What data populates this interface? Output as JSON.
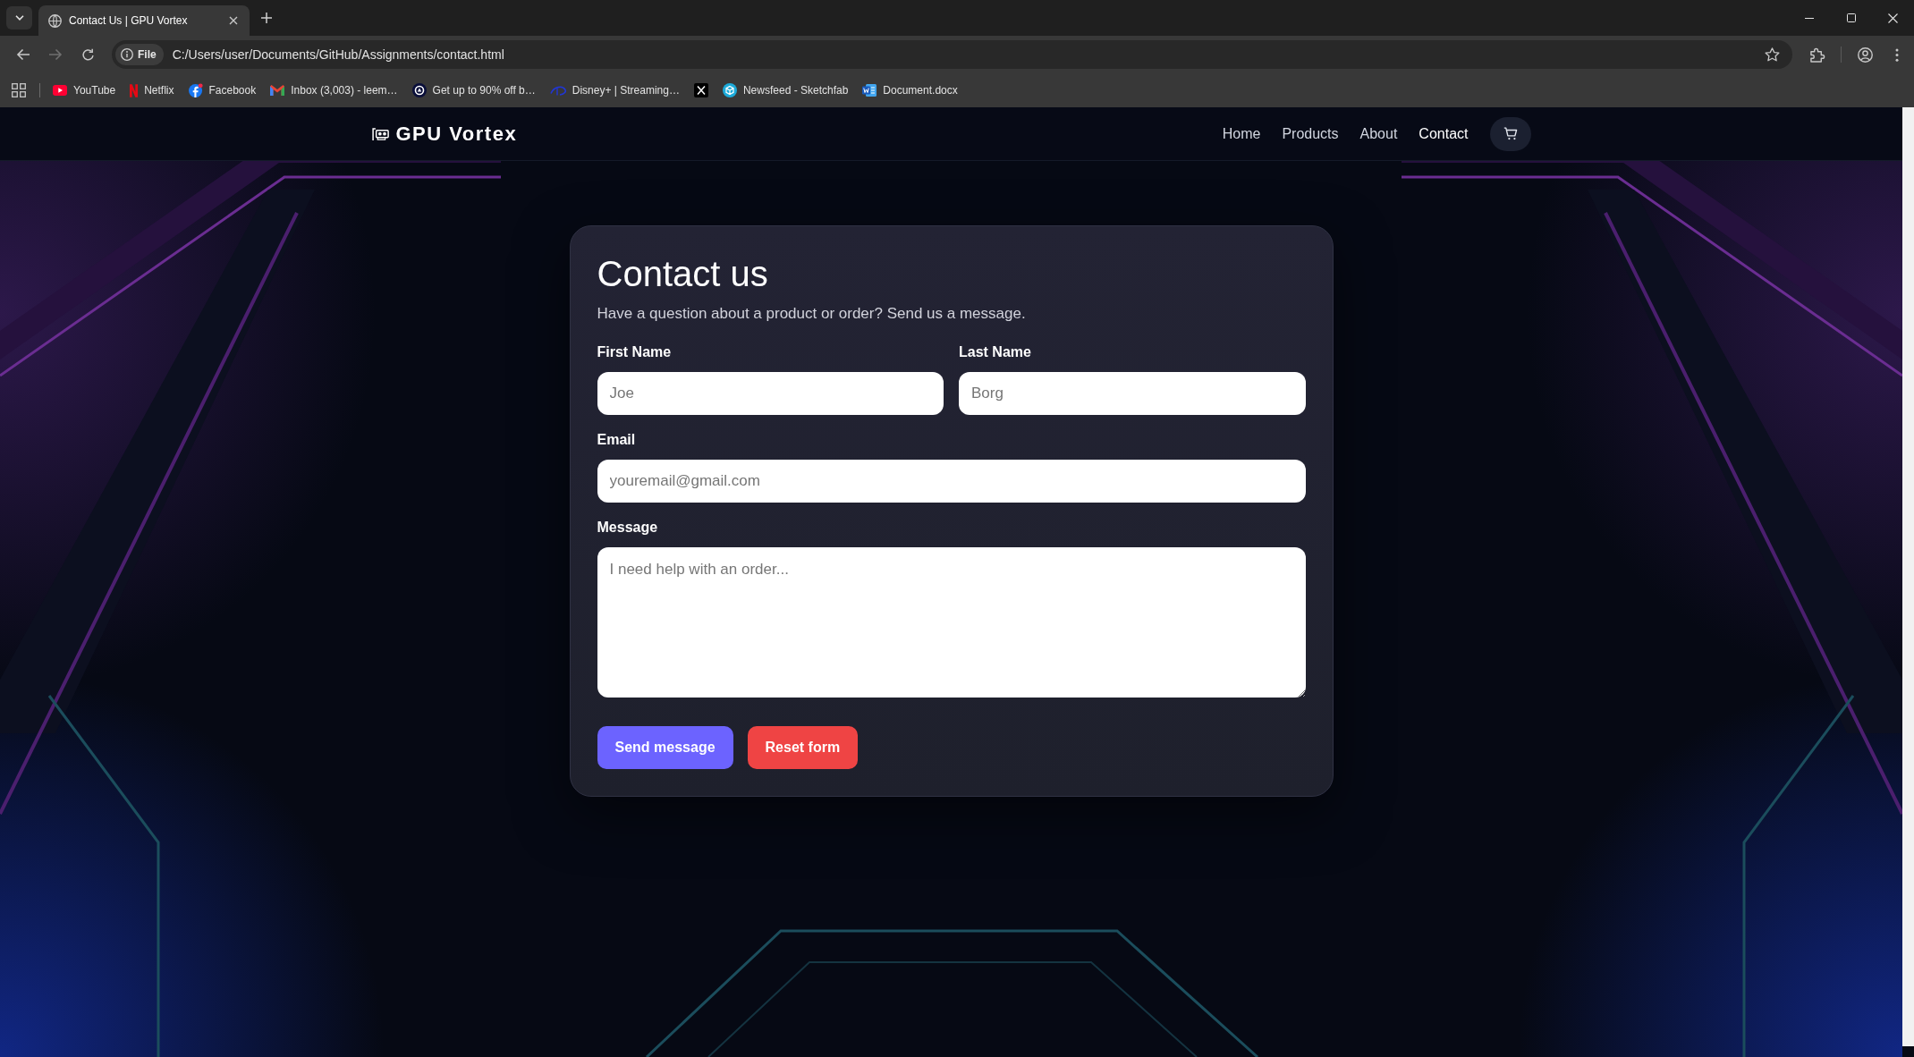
{
  "browser": {
    "tabs": [
      {
        "title": "Contact Us | GPU Vortex",
        "selected": true
      }
    ],
    "toolbar": {
      "back": {
        "disabled": false
      },
      "forward": {
        "disabled": true
      }
    },
    "address_bar": {
      "chip": "File",
      "url": "C:/Users/user/Documents/GitHub/Assignments/contact.html"
    },
    "bookmarks": [
      {
        "kind": "link",
        "label": "YouTube"
      },
      {
        "kind": "link",
        "label": "Netflix"
      },
      {
        "kind": "link",
        "label": "Facebook"
      },
      {
        "kind": "link",
        "label": "Inbox (3,003) - leem…"
      },
      {
        "kind": "link",
        "label": "Get up to 90% off b…"
      },
      {
        "kind": "link",
        "label": "Disney+ | Streaming…"
      },
      {
        "kind": "icon"
      },
      {
        "kind": "link",
        "label": "Newsfeed - Sketchfab"
      },
      {
        "kind": "link",
        "label": "Document.docx"
      }
    ]
  },
  "site": {
    "logo": "GPU Vortex",
    "nav": [
      {
        "label": "Home",
        "selected": false
      },
      {
        "label": "Products",
        "selected": false
      },
      {
        "label": "About",
        "selected": false
      },
      {
        "label": "Contact",
        "selected": true
      }
    ]
  },
  "contact_form": {
    "title": "Contact us",
    "subtitle": "Have a question about a product or order? Send us a message.",
    "rows": [
      {
        "fields": [
          {
            "kind": "text",
            "label": "First Name",
            "placeholder": "Joe"
          },
          {
            "kind": "text",
            "label": "Last Name",
            "placeholder": "Borg"
          }
        ]
      },
      {
        "fields": [
          {
            "kind": "email",
            "label": "Email",
            "placeholder": "youremail@gmail.com"
          }
        ]
      },
      {
        "fields": [
          {
            "kind": "textarea",
            "label": "Message",
            "placeholder": "I need help with an order..."
          }
        ]
      }
    ],
    "buttons": [
      {
        "kind": "submit",
        "label": "Send message"
      },
      {
        "kind": "reset",
        "label": "Reset form"
      }
    ]
  }
}
